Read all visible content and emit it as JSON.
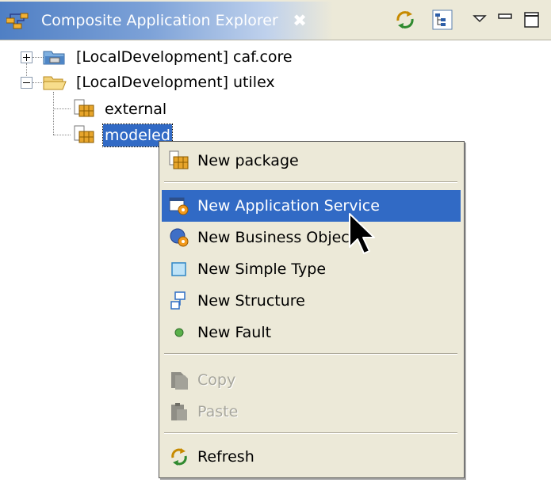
{
  "view": {
    "title": "Composite Application Explorer",
    "close_glyph": "✖",
    "toolbar_icons": [
      "sync-icon",
      "tree-layout-icon",
      "view-menu-icon",
      "minimize-icon",
      "maximize-icon"
    ]
  },
  "tree": {
    "projects": [
      {
        "label": "[LocalDevelopment] caf.core",
        "expanded": false,
        "icon": "folder-closed-icon"
      },
      {
        "label": "[LocalDevelopment] utilex",
        "expanded": true,
        "icon": "folder-open-icon",
        "children": [
          {
            "label": "external",
            "icon": "package-icon",
            "selected": false
          },
          {
            "label": "modeled",
            "icon": "package-icon",
            "selected": true
          }
        ]
      }
    ]
  },
  "context_menu": {
    "groups": [
      [
        {
          "label": "New package",
          "icon": "package-icon",
          "enabled": true,
          "hover": false
        }
      ],
      [
        {
          "label": "New Application Service",
          "icon": "application-service-icon",
          "enabled": true,
          "hover": true
        },
        {
          "label": "New Business Object",
          "icon": "business-object-icon",
          "enabled": true,
          "hover": false
        },
        {
          "label": "New Simple Type",
          "icon": "simple-type-icon",
          "enabled": true,
          "hover": false
        },
        {
          "label": "New Structure",
          "icon": "structure-icon",
          "enabled": true,
          "hover": false
        },
        {
          "label": "New Fault",
          "icon": "fault-icon",
          "enabled": true,
          "hover": false
        }
      ],
      [
        {
          "label": "Copy",
          "icon": "copy-icon",
          "enabled": false,
          "hover": false
        },
        {
          "label": "Paste",
          "icon": "paste-icon",
          "enabled": false,
          "hover": false
        }
      ],
      [
        {
          "label": "Refresh",
          "icon": "refresh-icon",
          "enabled": true,
          "hover": false
        }
      ]
    ]
  },
  "colors": {
    "selection": "#316ac5",
    "menu_background": "#ece9d8",
    "title_gradient_start": "#4f7fc4",
    "disabled_text": "#a7a69c"
  }
}
